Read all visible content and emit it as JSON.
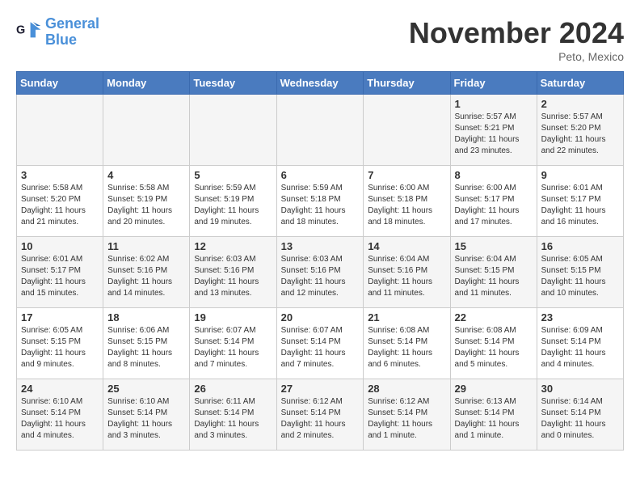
{
  "logo": {
    "line1": "General",
    "line2": "Blue"
  },
  "title": "November 2024",
  "location": "Peto, Mexico",
  "days_header": [
    "Sunday",
    "Monday",
    "Tuesday",
    "Wednesday",
    "Thursday",
    "Friday",
    "Saturday"
  ],
  "weeks": [
    [
      {
        "day": "",
        "sunrise": "",
        "sunset": "",
        "daylight": ""
      },
      {
        "day": "",
        "sunrise": "",
        "sunset": "",
        "daylight": ""
      },
      {
        "day": "",
        "sunrise": "",
        "sunset": "",
        "daylight": ""
      },
      {
        "day": "",
        "sunrise": "",
        "sunset": "",
        "daylight": ""
      },
      {
        "day": "",
        "sunrise": "",
        "sunset": "",
        "daylight": ""
      },
      {
        "day": "1",
        "sunrise": "Sunrise: 5:57 AM",
        "sunset": "Sunset: 5:21 PM",
        "daylight": "Daylight: 11 hours and 23 minutes."
      },
      {
        "day": "2",
        "sunrise": "Sunrise: 5:57 AM",
        "sunset": "Sunset: 5:20 PM",
        "daylight": "Daylight: 11 hours and 22 minutes."
      }
    ],
    [
      {
        "day": "3",
        "sunrise": "Sunrise: 5:58 AM",
        "sunset": "Sunset: 5:20 PM",
        "daylight": "Daylight: 11 hours and 21 minutes."
      },
      {
        "day": "4",
        "sunrise": "Sunrise: 5:58 AM",
        "sunset": "Sunset: 5:19 PM",
        "daylight": "Daylight: 11 hours and 20 minutes."
      },
      {
        "day": "5",
        "sunrise": "Sunrise: 5:59 AM",
        "sunset": "Sunset: 5:19 PM",
        "daylight": "Daylight: 11 hours and 19 minutes."
      },
      {
        "day": "6",
        "sunrise": "Sunrise: 5:59 AM",
        "sunset": "Sunset: 5:18 PM",
        "daylight": "Daylight: 11 hours and 18 minutes."
      },
      {
        "day": "7",
        "sunrise": "Sunrise: 6:00 AM",
        "sunset": "Sunset: 5:18 PM",
        "daylight": "Daylight: 11 hours and 18 minutes."
      },
      {
        "day": "8",
        "sunrise": "Sunrise: 6:00 AM",
        "sunset": "Sunset: 5:17 PM",
        "daylight": "Daylight: 11 hours and 17 minutes."
      },
      {
        "day": "9",
        "sunrise": "Sunrise: 6:01 AM",
        "sunset": "Sunset: 5:17 PM",
        "daylight": "Daylight: 11 hours and 16 minutes."
      }
    ],
    [
      {
        "day": "10",
        "sunrise": "Sunrise: 6:01 AM",
        "sunset": "Sunset: 5:17 PM",
        "daylight": "Daylight: 11 hours and 15 minutes."
      },
      {
        "day": "11",
        "sunrise": "Sunrise: 6:02 AM",
        "sunset": "Sunset: 5:16 PM",
        "daylight": "Daylight: 11 hours and 14 minutes."
      },
      {
        "day": "12",
        "sunrise": "Sunrise: 6:03 AM",
        "sunset": "Sunset: 5:16 PM",
        "daylight": "Daylight: 11 hours and 13 minutes."
      },
      {
        "day": "13",
        "sunrise": "Sunrise: 6:03 AM",
        "sunset": "Sunset: 5:16 PM",
        "daylight": "Daylight: 11 hours and 12 minutes."
      },
      {
        "day": "14",
        "sunrise": "Sunrise: 6:04 AM",
        "sunset": "Sunset: 5:16 PM",
        "daylight": "Daylight: 11 hours and 11 minutes."
      },
      {
        "day": "15",
        "sunrise": "Sunrise: 6:04 AM",
        "sunset": "Sunset: 5:15 PM",
        "daylight": "Daylight: 11 hours and 11 minutes."
      },
      {
        "day": "16",
        "sunrise": "Sunrise: 6:05 AM",
        "sunset": "Sunset: 5:15 PM",
        "daylight": "Daylight: 11 hours and 10 minutes."
      }
    ],
    [
      {
        "day": "17",
        "sunrise": "Sunrise: 6:05 AM",
        "sunset": "Sunset: 5:15 PM",
        "daylight": "Daylight: 11 hours and 9 minutes."
      },
      {
        "day": "18",
        "sunrise": "Sunrise: 6:06 AM",
        "sunset": "Sunset: 5:15 PM",
        "daylight": "Daylight: 11 hours and 8 minutes."
      },
      {
        "day": "19",
        "sunrise": "Sunrise: 6:07 AM",
        "sunset": "Sunset: 5:14 PM",
        "daylight": "Daylight: 11 hours and 7 minutes."
      },
      {
        "day": "20",
        "sunrise": "Sunrise: 6:07 AM",
        "sunset": "Sunset: 5:14 PM",
        "daylight": "Daylight: 11 hours and 7 minutes."
      },
      {
        "day": "21",
        "sunrise": "Sunrise: 6:08 AM",
        "sunset": "Sunset: 5:14 PM",
        "daylight": "Daylight: 11 hours and 6 minutes."
      },
      {
        "day": "22",
        "sunrise": "Sunrise: 6:08 AM",
        "sunset": "Sunset: 5:14 PM",
        "daylight": "Daylight: 11 hours and 5 minutes."
      },
      {
        "day": "23",
        "sunrise": "Sunrise: 6:09 AM",
        "sunset": "Sunset: 5:14 PM",
        "daylight": "Daylight: 11 hours and 4 minutes."
      }
    ],
    [
      {
        "day": "24",
        "sunrise": "Sunrise: 6:10 AM",
        "sunset": "Sunset: 5:14 PM",
        "daylight": "Daylight: 11 hours and 4 minutes."
      },
      {
        "day": "25",
        "sunrise": "Sunrise: 6:10 AM",
        "sunset": "Sunset: 5:14 PM",
        "daylight": "Daylight: 11 hours and 3 minutes."
      },
      {
        "day": "26",
        "sunrise": "Sunrise: 6:11 AM",
        "sunset": "Sunset: 5:14 PM",
        "daylight": "Daylight: 11 hours and 3 minutes."
      },
      {
        "day": "27",
        "sunrise": "Sunrise: 6:12 AM",
        "sunset": "Sunset: 5:14 PM",
        "daylight": "Daylight: 11 hours and 2 minutes."
      },
      {
        "day": "28",
        "sunrise": "Sunrise: 6:12 AM",
        "sunset": "Sunset: 5:14 PM",
        "daylight": "Daylight: 11 hours and 1 minute."
      },
      {
        "day": "29",
        "sunrise": "Sunrise: 6:13 AM",
        "sunset": "Sunset: 5:14 PM",
        "daylight": "Daylight: 11 hours and 1 minute."
      },
      {
        "day": "30",
        "sunrise": "Sunrise: 6:14 AM",
        "sunset": "Sunset: 5:14 PM",
        "daylight": "Daylight: 11 hours and 0 minutes."
      }
    ]
  ]
}
